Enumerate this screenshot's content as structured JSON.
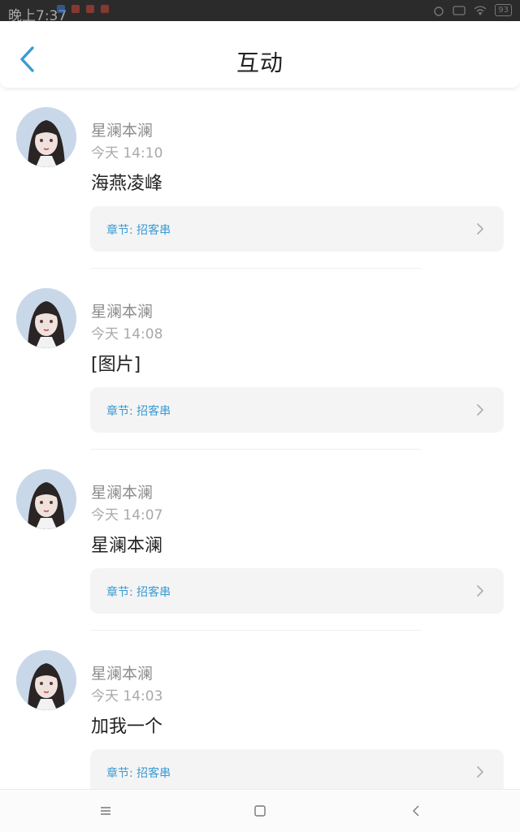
{
  "status_bar": {
    "time": "晚上7:37",
    "battery": "93"
  },
  "header": {
    "title": "互动",
    "back_icon": "chevron-left-icon"
  },
  "items": [
    {
      "name": "星澜本澜",
      "time": "今天 14:10",
      "content": "海燕凌峰",
      "chapter": "章节: 招客串"
    },
    {
      "name": "星澜本澜",
      "time": "今天 14:08",
      "content": "[图片]",
      "chapter": "章节: 招客串"
    },
    {
      "name": "星澜本澜",
      "time": "今天 14:07",
      "content": "星澜本澜",
      "chapter": "章节: 招客串"
    },
    {
      "name": "星澜本澜",
      "time": "今天 14:03",
      "content": "加我一个",
      "chapter": "章节: 招客串"
    }
  ],
  "navbar": {
    "menu_icon": "menu-icon",
    "home_icon": "square-icon",
    "back_icon": "back-icon"
  },
  "colors": {
    "accent": "#3a9bd5",
    "status_bar_bg": "#2b2b2b"
  }
}
